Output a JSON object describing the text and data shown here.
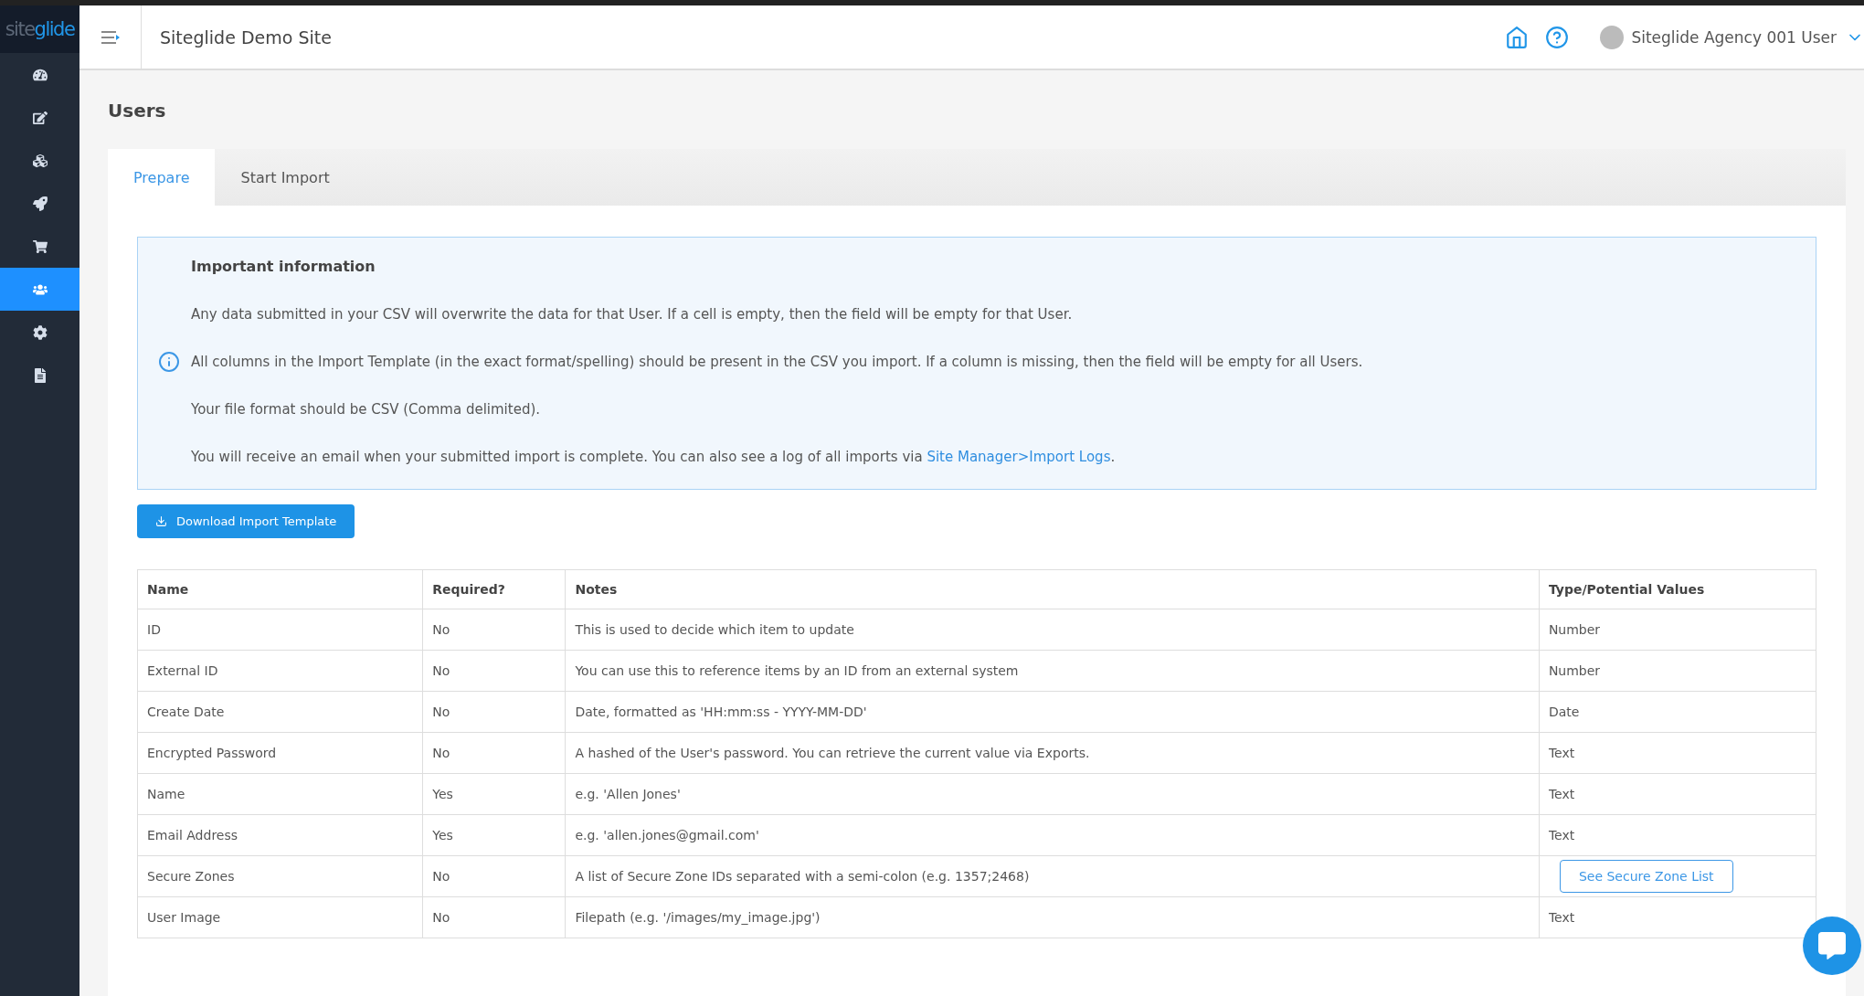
{
  "sidebar": {
    "logo": {
      "part1": "site",
      "part2": "glide"
    },
    "items": [
      {
        "selected": false
      },
      {
        "selected": false
      },
      {
        "selected": false
      },
      {
        "selected": false
      },
      {
        "selected": false
      },
      {
        "selected": true
      },
      {
        "selected": false
      },
      {
        "selected": false
      }
    ]
  },
  "header": {
    "site_title": "Siteglide Demo Site",
    "user_name": "Siteglide Agency 001 User"
  },
  "page_title": "Users",
  "tabs": [
    {
      "label": "Prepare",
      "selected": true
    },
    {
      "label": "Start Import",
      "selected": false
    }
  ],
  "info": {
    "title": "Important information",
    "paragraphs": [
      {
        "text": "Any data submitted in your CSV will overwrite the data for that User. If a cell is empty, then the field will be empty for that User."
      },
      {
        "text": "All columns in the Import Template (in the exact format/spelling) should be present in the CSV you import. If a column is missing, then the field will be empty for all Users."
      },
      {
        "text": "Your file format should be CSV (Comma delimited)."
      },
      {
        "text": "You will receive an email when your submitted import is complete. You can also see a log of all imports via ",
        "link": "Site Manager>Import Logs",
        "after": "."
      }
    ]
  },
  "download_button": "Download Import Template",
  "table": {
    "columns": [
      "Name",
      "Required?",
      "Notes",
      "Type/Potential Values"
    ],
    "rows": [
      {
        "name": "ID",
        "required": "No",
        "notes": "This is used to decide which item to update",
        "kind": "text",
        "type": "Number"
      },
      {
        "name": "External ID",
        "required": "No",
        "notes": "You can use this to reference items by an ID from an external system",
        "kind": "text",
        "type": "Number"
      },
      {
        "name": "Create Date",
        "required": "No",
        "notes": "Date, formatted as 'HH:mm:ss - YYYY-MM-DD'",
        "kind": "text",
        "type": "Date"
      },
      {
        "name": "Encrypted Password",
        "required": "No",
        "notes": "A hashed of the User's password. You can retrieve the current value via Exports.",
        "kind": "text",
        "type": "Text"
      },
      {
        "name": "Name",
        "required": "Yes",
        "notes": "e.g. 'Allen Jones'",
        "kind": "text",
        "type": "Text"
      },
      {
        "name": "Email Address",
        "required": "Yes",
        "notes": "e.g. 'allen.jones@gmail.com'",
        "kind": "text",
        "type": "Text"
      },
      {
        "name": "Secure Zones",
        "required": "No",
        "notes": "A list of Secure Zone IDs separated with a semi-colon (e.g. 1357;2468)",
        "kind": "button",
        "type": "See Secure Zone List"
      },
      {
        "name": "User Image",
        "required": "No",
        "notes": "Filepath (e.g. '/images/my_image.jpg')",
        "kind": "text",
        "type": "Text"
      }
    ]
  }
}
